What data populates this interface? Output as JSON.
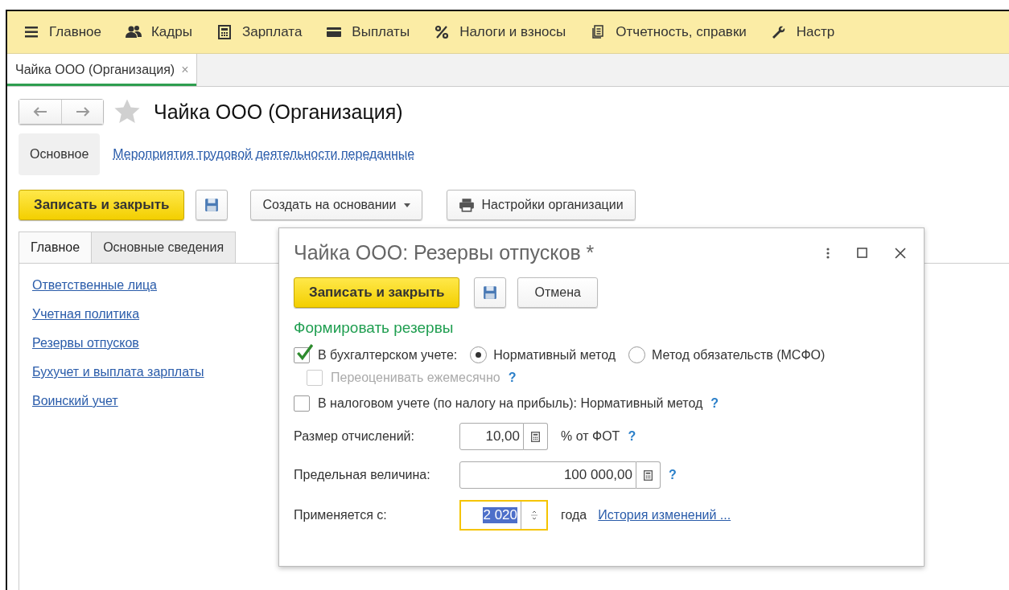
{
  "menu": [
    {
      "kind": "menu",
      "label": "Главное"
    },
    {
      "kind": "people",
      "label": "Кадры"
    },
    {
      "kind": "calculator",
      "label": "Зарплата"
    },
    {
      "kind": "card",
      "label": "Выплаты"
    },
    {
      "kind": "percent",
      "label": "Налоги и взносы"
    },
    {
      "kind": "documents",
      "label": "Отчетность, справки"
    },
    {
      "kind": "wrench",
      "label": "Настр"
    }
  ],
  "open_tabs": [
    {
      "label": "Чайка ООО (Организация)",
      "close": "×",
      "selected": true
    }
  ],
  "form": {
    "title": "Чайка ООО (Организация)",
    "sections": [
      {
        "label": "Основное",
        "selected": true
      },
      {
        "label": "Мероприятия трудовой деятельности переданные",
        "selected": false
      }
    ],
    "save_close": "Записать и закрыть",
    "create_based": "Создать на основании",
    "settings": "Настройки организации",
    "tabs": [
      {
        "label": "Главное",
        "selected": true
      },
      {
        "label": "Основные сведения",
        "selected": false
      }
    ],
    "links": [
      "Ответственные лица",
      "Учетная политика",
      "Резервы отпусков",
      "Бухучет и выплата зарплаты",
      "Воинский учет"
    ]
  },
  "dialog": {
    "title": "Чайка ООО: Резервы отпусков *",
    "save_close": "Записать и закрыть",
    "cancel": "Отмена",
    "heading": "Формировать резервы",
    "accounting": {
      "label": "В бухгалтерском учете:",
      "checked": true,
      "options": [
        {
          "label": "Нормативный метод",
          "selected": true
        },
        {
          "label": "Метод обязательств (МСФО)",
          "selected": false
        }
      ]
    },
    "revalue": {
      "label": "Переоценивать ежемесячно",
      "checked": false,
      "disabled": true,
      "help": "?"
    },
    "tax": {
      "label": "В налоговом учете (по налогу на прибыль): Нормативный метод",
      "checked": false,
      "disabled": false,
      "help": "?"
    },
    "rate": {
      "label": "Размер отчислений:",
      "value": "10,00",
      "suffix": "% от ФОТ",
      "help": "?"
    },
    "limit": {
      "label": "Предельная величина:",
      "value": "100 000,00",
      "help": "?"
    },
    "since": {
      "label": "Применяется с:",
      "value": "2 020",
      "focused": true,
      "suffix": "года",
      "link": "История изменений ..."
    }
  }
}
